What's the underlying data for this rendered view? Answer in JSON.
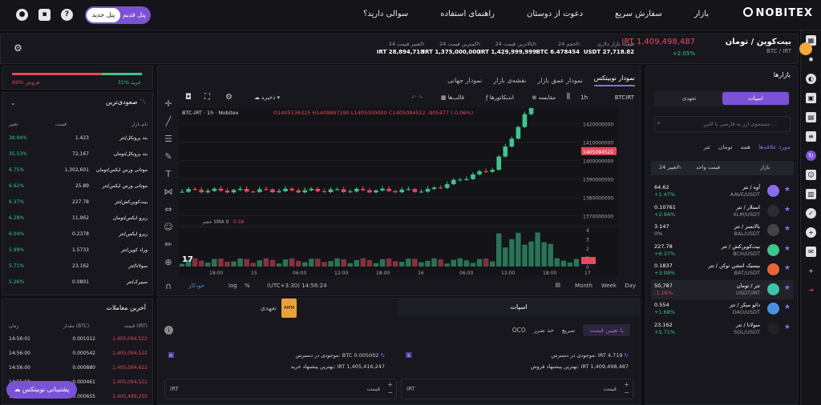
{
  "header": {
    "logo": "NOBITEX",
    "nav": [
      "بازار",
      "سفارش سریع",
      "دعوت از دوستان",
      "راهنمای استفاده",
      "سوالی دارید؟"
    ],
    "panel_new": "پنل جدید",
    "panel_old": "پنل قدیم"
  },
  "pair": {
    "name": "بیت‌کوین / تومان",
    "symbol": "BTC / IRT",
    "price": "IRT 1,409,498,487",
    "change": "+2.05%"
  },
  "stats": [
    {
      "label": "قیمت بازار دلاری",
      "value": "USDT 27,718.82"
    },
    {
      "label": "حجم 24h",
      "value": "BTC 6.478454"
    },
    {
      "label": "بالاترین قیمت 24h",
      "value": "IRT 1,429,999,999"
    },
    {
      "label": "کمترین قیمت 24h",
      "value": "IRT 1,375,000,000"
    },
    {
      "label": "تغییر قیمت 24h",
      "value": "IRT 28,894,718"
    }
  ],
  "markets": {
    "title": "بازارها",
    "seg_spot": "اسپات",
    "seg_fut": "تعهدی",
    "search_placeholder": "جستجوی ارز به فارسی یا لاتین ...",
    "filters": [
      "مورد علاقه‌ها",
      "همه",
      "تومان",
      "تتر"
    ],
    "col_market": "بازار",
    "col_price": "قیمت واحد",
    "col_change": "تغییر 24h",
    "rows": [
      {
        "name": "آوه / تتر",
        "sym": "AAVE/USDT",
        "price": "64.62",
        "chg": "+1.47%",
        "color": "#8a6cf0",
        "chgcolor": "#3ec48c"
      },
      {
        "name": "استلار / تتر",
        "sym": "XLM/USDT",
        "price": "0.10761",
        "chg": "+2.94%",
        "color": "#2b2b33",
        "chgcolor": "#3ec48c"
      },
      {
        "name": "بالانسر / تتر",
        "sym": "BAL/USDT",
        "price": "3.147",
        "chg": "0%",
        "color": "#444",
        "chgcolor": "#aaa"
      },
      {
        "name": "بیت‌کوین‌کش / تتر",
        "sym": "BCH/USDT",
        "price": "227.78",
        "chg": "+6.37%",
        "color": "#3ec48c",
        "chgcolor": "#3ec48c"
      },
      {
        "name": "بیسیک اتنشن توکن / تتر",
        "sym": "BAT/USDT",
        "price": "0.1837",
        "chg": "+3.09%",
        "color": "#e8653a",
        "chgcolor": "#3ec48c"
      },
      {
        "name": "تتر / تومان",
        "sym": "USDT/IRT",
        "price": "50,787",
        "chg": "-1.16%",
        "color": "#3ec4a8",
        "chgcolor": "#e64a5e"
      },
      {
        "name": "دائو میکر / تتر",
        "sym": "DAO/USDT",
        "price": "0.554",
        "chg": "+1.68%",
        "color": "#4a90e2",
        "chgcolor": "#3ec48c"
      },
      {
        "name": "سولانا / تتر",
        "sym": "SOL/USDT",
        "price": "23.162",
        "chg": "+5.71%",
        "color": "#222",
        "chgcolor": "#3ec48c"
      }
    ]
  },
  "chart": {
    "tabs": [
      "نمودار نوبیتکس",
      "نمودار عمق بازار",
      "نقشه‌ی بازار",
      "نمودار جهانی"
    ],
    "symbol": "BTCIRT",
    "interval": "1h",
    "compare": "مقایسه",
    "indicators": "اندیکاتورها",
    "templates": "قالب‌ها",
    "save": "ذخیره",
    "legend": "BTC-IRT · 1h · Nobitex",
    "ohlc": "O1405136325 H1409897190 L1405000000 C1405094522 -905477 (-0.06%)",
    "vol": "حجم SMA 9",
    "vol_val": "0.58",
    "last": "1405094522",
    "ranges": [
      "Day",
      "Week",
      "Month"
    ],
    "time": "(UTC+3:30) 14:56:24",
    "scale": [
      "%",
      "log",
      "خودکار"
    ],
    "chart_data": {
      "type": "candlestick",
      "y_ticks": [
        1420000000,
        1410000000,
        1400000000,
        1390000000,
        1380000000,
        1370000000
      ],
      "x_ticks": [
        "18:00",
        "15",
        "06:00",
        "12:00",
        "18:00",
        "16",
        "06:00",
        "12:00",
        "18:00",
        "17"
      ],
      "vol_ticks": [
        4,
        3,
        2,
        1,
        0
      ]
    }
  },
  "orders": {
    "spot": "اسپات",
    "futures": "تعهدی",
    "amm": "AMM",
    "types": [
      "با تعیین قیمت",
      "سریع",
      "حد ضرر",
      "OCO"
    ],
    "left": {
      "avail_label": "موجودی در دسترس:",
      "avail": "BTC 0.005002",
      "best_label": "بهترین پیشنهاد خرید:",
      "best": "IRT 1,405,416,247",
      "inp_unit": "IRT",
      "inp_label": "قیمت"
    },
    "right": {
      "avail_label": "موجودی در دسترس:",
      "avail": "IRT 4,719",
      "best_label": "بهترین پیشنهاد فروش:",
      "best": "IRT 1,409,498,487",
      "inp_unit": "IRT",
      "inp_label": "قیمت"
    }
  },
  "ratio": {
    "buy": "31% خرید",
    "sell": "69% فروش",
    "buy_frac": 0.31
  },
  "top": {
    "title": "صعودی‌ترین",
    "cols": [
      "نام بازار",
      "قیمت",
      "تغییر"
    ],
    "rows": [
      [
        "بند پروتکل/تتر",
        "1.423",
        "38.94%"
      ],
      [
        "بند پروتکل/تومان",
        "72,167",
        "35.53%"
      ],
      [
        "موتانی ورس ایکس/تومان",
        "1,302,601",
        "6.75%"
      ],
      [
        "موتانی ورس ایکس/تتر",
        "25.89",
        "6.62%"
      ],
      [
        "بیت‌کوین‌کش/تتر",
        "227.78",
        "6.37%"
      ],
      [
        "زیرو ایکس/تومان",
        "11,962",
        "6.28%"
      ],
      [
        "زیرو ایکس/تتر",
        "0.2378",
        "6.04%"
      ],
      [
        "وراد کوین/تتر",
        "1.5733",
        "5.99%"
      ],
      [
        "سولانا/تتر",
        "23.162",
        "5.71%"
      ],
      [
        "سیپرک/تتر",
        "0.0801",
        "5.26%"
      ]
    ]
  },
  "trades": {
    "title": "آخرین معاملات",
    "cols": [
      "زمان",
      "مقدار (BTC)",
      "قیمت (IRT)"
    ],
    "rows": [
      [
        "14:56:01",
        "0.001012",
        "1,405,094,522"
      ],
      [
        "14:56:00",
        "0.000542",
        "1,405,094,522"
      ],
      [
        "14:56:00",
        "0.000880",
        "1,405,094,622"
      ],
      [
        "14:55:58",
        "0.000461",
        "1,405,094,522"
      ],
      [
        "14:55:36",
        "0.000655",
        "1,405,489,255"
      ]
    ]
  },
  "support": "پشتیبانی نوبیتکس"
}
